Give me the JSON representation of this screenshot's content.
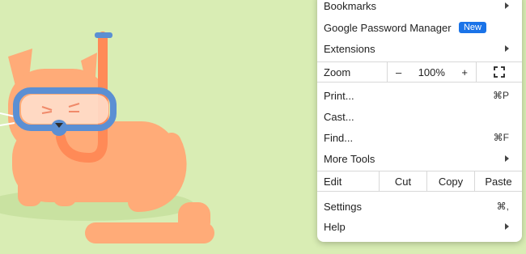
{
  "menu": {
    "bookmarks": "Bookmarks",
    "password_manager": "Google Password Manager",
    "new_badge": "New",
    "extensions": "Extensions",
    "zoom": {
      "label": "Zoom",
      "minus": "–",
      "value": "100%",
      "plus": "+"
    },
    "print": {
      "label": "Print...",
      "shortcut": "⌘P"
    },
    "cast": "Cast...",
    "find": {
      "label": "Find...",
      "shortcut": "⌘F"
    },
    "more_tools": "More Tools",
    "edit": {
      "label": "Edit",
      "cut": "Cut",
      "copy": "Copy",
      "paste": "Paste"
    },
    "settings": {
      "label": "Settings",
      "shortcut": "⌘,"
    },
    "help": "Help"
  },
  "icons": [
    "fullscreen-icon",
    "submenu-arrow-icon"
  ],
  "colors": {
    "background": "#d9edb4",
    "cat": "#ffab78",
    "goggles": "#5b8fd3",
    "badge": "#1a73e8"
  }
}
